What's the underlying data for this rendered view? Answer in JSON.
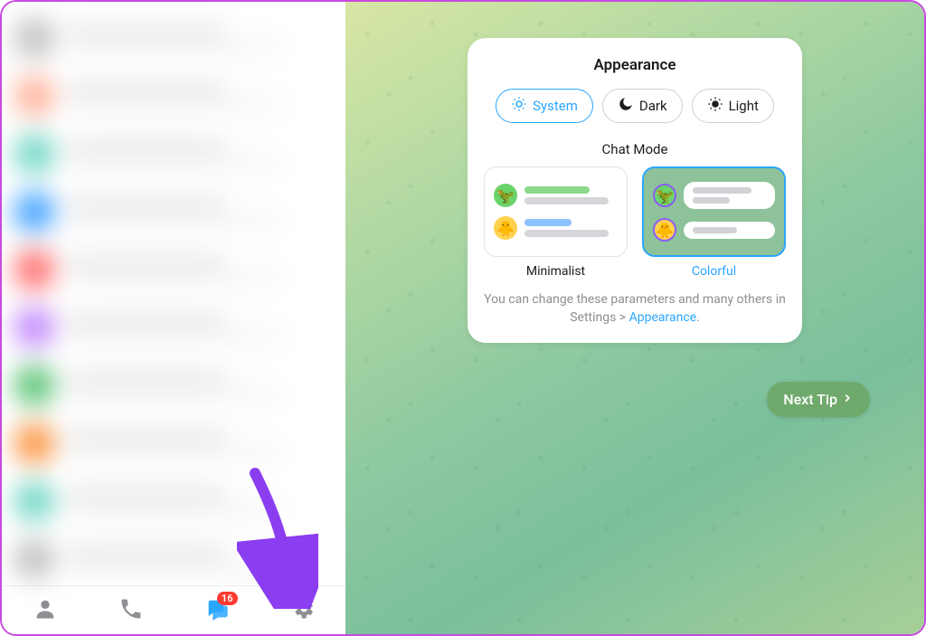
{
  "nav": {
    "badge_count": "16"
  },
  "card": {
    "title": "Appearance",
    "themes": {
      "system": "System",
      "dark": "Dark",
      "light": "Light"
    },
    "chat_mode_title": "Chat Mode",
    "modes": {
      "minimalist": "Minimalist",
      "colorful": "Colorful"
    },
    "footer_prefix": "You can change these parameters and many others in Settings > ",
    "footer_link": "Appearance",
    "footer_suffix": "."
  },
  "next_tip": "Next Tip"
}
